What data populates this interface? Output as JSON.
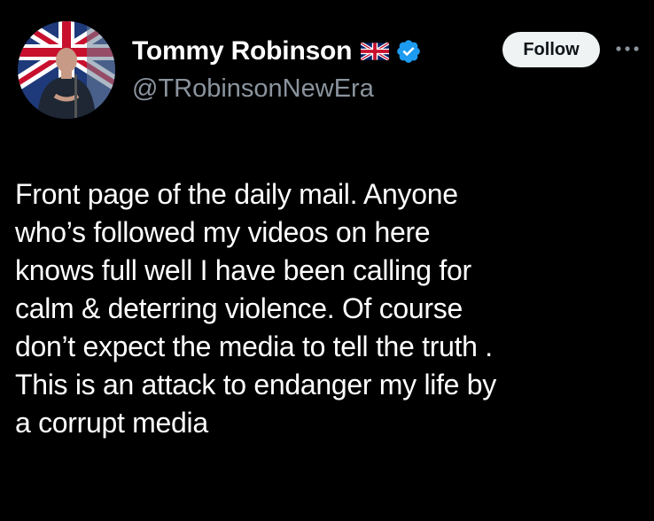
{
  "author": {
    "display_name": "Tommy Robinson",
    "handle": "@TRobinsonNewEra",
    "badges": [
      "uk-flag-icon",
      "verified-badge-icon"
    ]
  },
  "actions": {
    "follow_label": "Follow",
    "more_icon": "more-horizontal-icon"
  },
  "tweet": {
    "lines": [
      "Front page of the daily mail. Anyone",
      "who’s followed my videos on here",
      "knows full well I have been calling for",
      "calm & deterring violence. Of course",
      "don’t expect the media to tell the truth  .",
      "This is an attack to endanger my life by",
      "a corrupt media"
    ]
  },
  "colors": {
    "background": "#000000",
    "text": "#ffffff",
    "secondary_text": "#8b949e",
    "verified_blue": "#1d9bf0",
    "follow_button_bg": "#eff3f4"
  }
}
